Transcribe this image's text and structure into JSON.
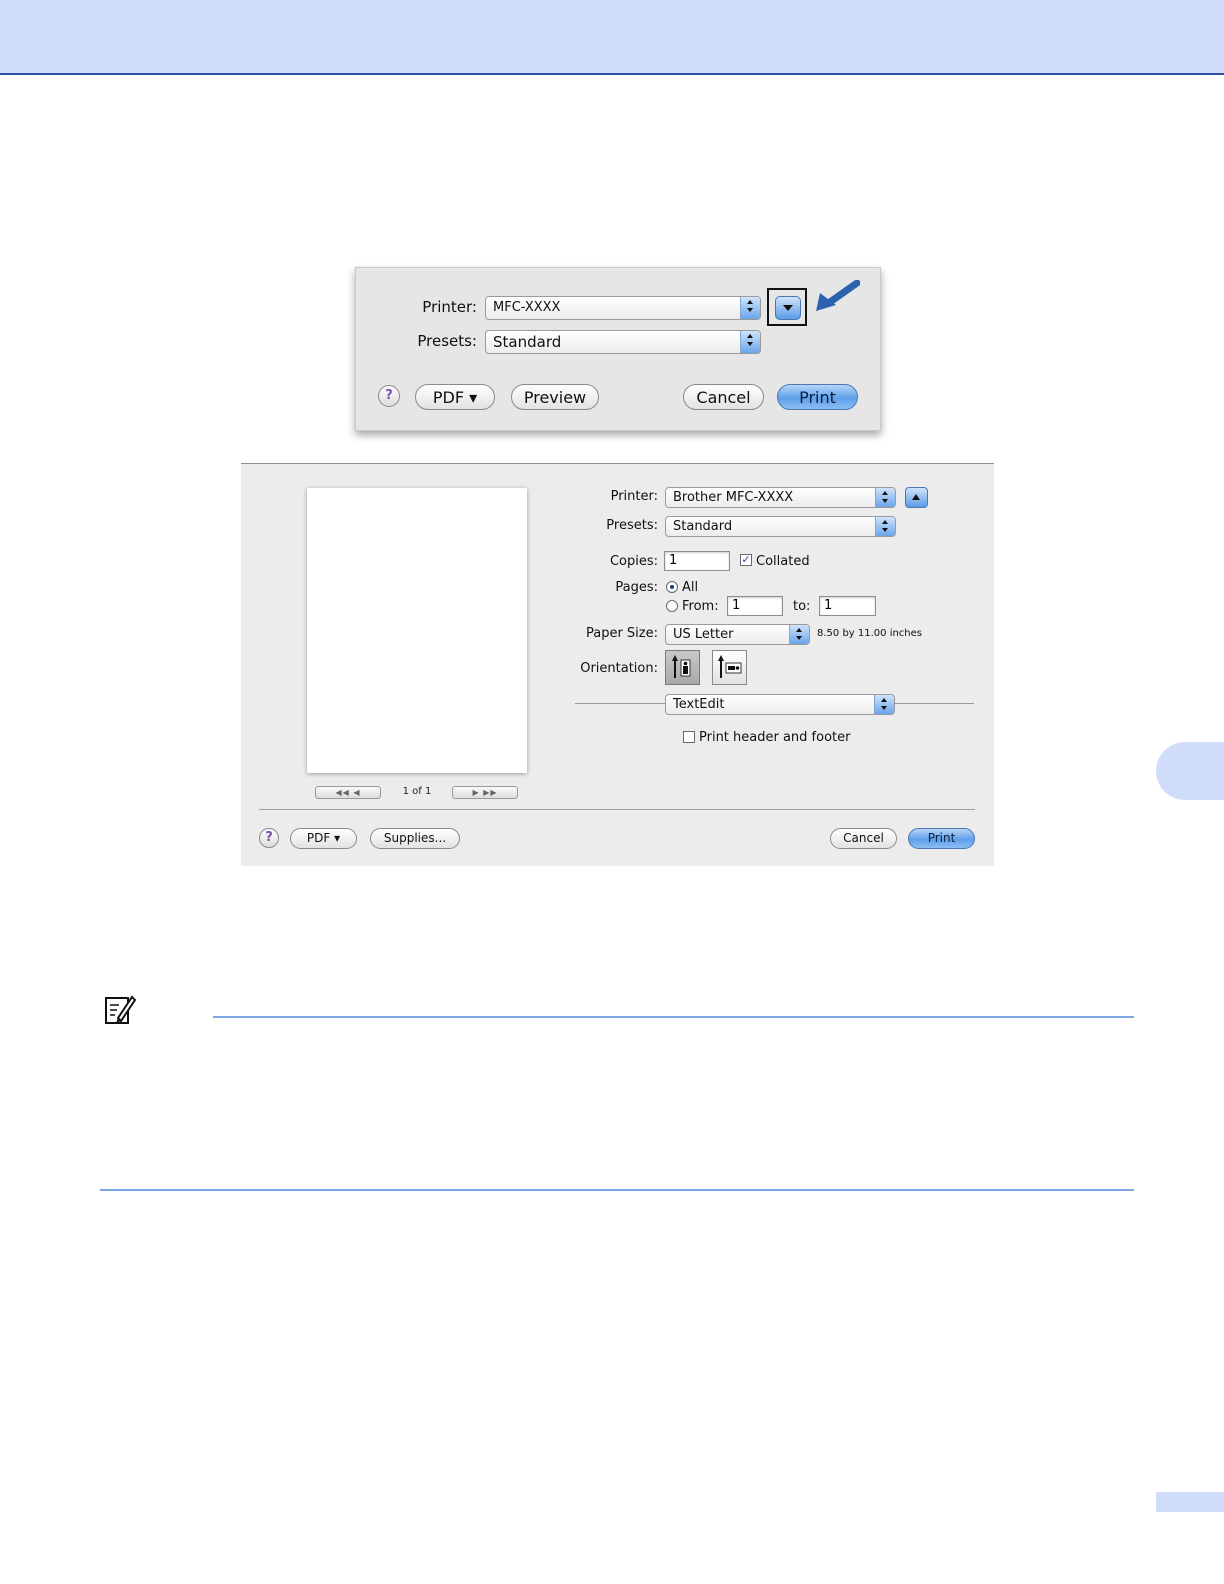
{
  "colors": {
    "header_band": "#cfdcfa",
    "rule_blue": "#7ba7e0",
    "arrow_blue": "#2a62b0",
    "print_button": "#6aa5ea"
  },
  "dialog_compact": {
    "printer_label": "Printer:",
    "printer_value": "MFC-XXXX",
    "presets_label": "Presets:",
    "presets_value": "Standard",
    "help_label": "?",
    "pdf_label": "PDF ▾",
    "preview_label": "Preview",
    "cancel_label": "Cancel",
    "print_label": "Print",
    "disclosure_icon": "disclosure-triangle-down-icon",
    "callout_icon": "arrow-icon"
  },
  "dialog_expanded": {
    "printer_label": "Printer:",
    "printer_value": "Brother MFC-XXXX",
    "presets_label": "Presets:",
    "presets_value": "Standard",
    "copies_label": "Copies:",
    "copies_value": "1",
    "collated_label": "Collated",
    "collated_checked": true,
    "pages_label": "Pages:",
    "pages_all_label": "All",
    "pages_from_label": "From:",
    "pages_from_value": "1",
    "pages_to_label": "to:",
    "pages_to_value": "1",
    "paper_size_label": "Paper Size:",
    "paper_size_value": "US Letter",
    "paper_size_dims": "8.50 by 11.00 inches",
    "orientation_label": "Orientation:",
    "app_panel_value": "TextEdit",
    "header_footer_label": "Print header and footer",
    "header_footer_checked": false,
    "page_counter": "1 of 1",
    "nav_back": "◀◀ ◀",
    "nav_forward": "▶ ▶▶",
    "help_label": "?",
    "pdf_label": "PDF ▾",
    "supplies_label": "Supplies...",
    "cancel_label": "Cancel",
    "print_label": "Print"
  }
}
